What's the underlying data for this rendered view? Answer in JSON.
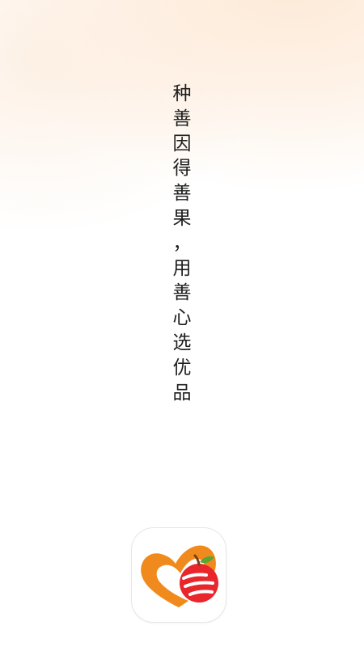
{
  "splash": {
    "slogan_chars": [
      "种",
      "善",
      "因",
      "得",
      "善",
      "果",
      "，",
      "用",
      "善",
      "心",
      "选",
      "优",
      "品"
    ]
  },
  "logo": {
    "icon": "heart-apple-logo-icon",
    "colors": {
      "heart": "#f08a1c",
      "apple": "#e8262b",
      "stripe": "#ffffff",
      "leaf": "#5aa634",
      "stem": "#7a3e1a"
    }
  }
}
